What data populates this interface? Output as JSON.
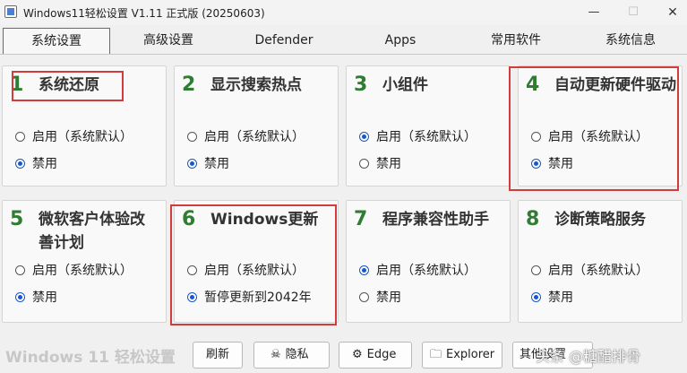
{
  "window": {
    "title": "Windows11轻松设置 V1.11 正式版 (20250603)",
    "min": "—",
    "max": "☐",
    "close": "✕"
  },
  "tabs": [
    "系统设置",
    "高级设置",
    "Defender",
    "Apps",
    "常用软件",
    "系统信息"
  ],
  "options": {
    "enable": "启用（系统默认）",
    "disable": "禁用",
    "pause": "暂停更新到2042年"
  },
  "cards": [
    {
      "num": "1",
      "title": "系统还原",
      "selected": "disable"
    },
    {
      "num": "2",
      "title": "显示搜索热点",
      "selected": "disable"
    },
    {
      "num": "3",
      "title": "小组件",
      "selected": "enable"
    },
    {
      "num": "4",
      "title": "自动更新硬件驱动",
      "selected": "disable"
    },
    {
      "num": "5",
      "title": "微软客户体验改善计划",
      "selected": "disable"
    },
    {
      "num": "6",
      "title": "Windows更新",
      "selected": "pause"
    },
    {
      "num": "7",
      "title": "程序兼容性助手",
      "selected": "enable"
    },
    {
      "num": "8",
      "title": "诊断策略服务",
      "selected": "disable"
    }
  ],
  "footer": {
    "brand": "Windows 11 轻松设置",
    "buttons": [
      {
        "label": "刷新",
        "icon": ""
      },
      {
        "label": "隐私",
        "icon": "☠"
      },
      {
        "label": "Edge",
        "icon": "⚙"
      },
      {
        "label": "Explorer",
        "icon": "🗀"
      },
      {
        "label": "其他设置",
        "icon": ""
      }
    ]
  },
  "watermark": "头条 @糖醋排骨"
}
